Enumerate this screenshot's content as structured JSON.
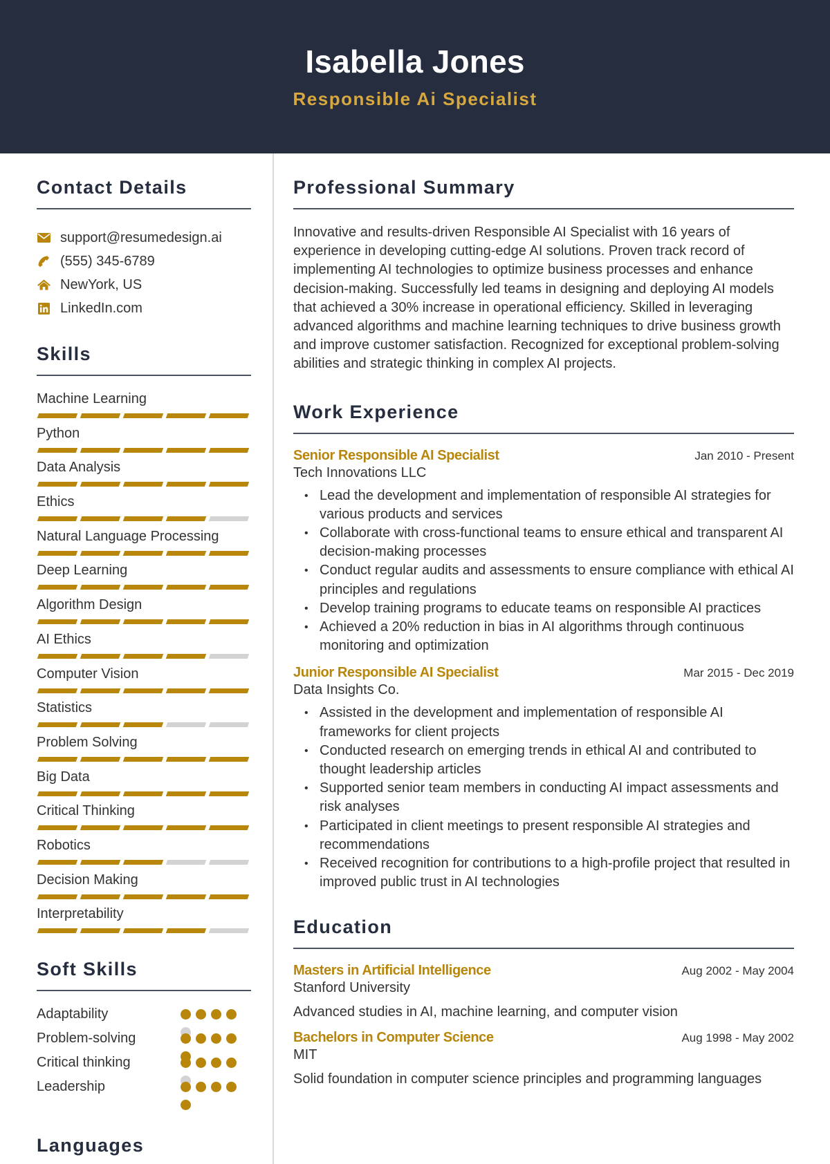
{
  "header": {
    "name": "Isabella Jones",
    "title": "Responsible Ai Specialist"
  },
  "colors": {
    "header_bg": "#252d3e",
    "accent": "#b8860b",
    "title_gold": "#d7a83f",
    "inactive": "#d3d3d3"
  },
  "contact": {
    "heading": "Contact Details",
    "items": [
      {
        "icon": "envelope-icon",
        "text": "support@resumedesign.ai"
      },
      {
        "icon": "phone-icon",
        "text": "(555) 345-6789"
      },
      {
        "icon": "home-icon",
        "text": "NewYork, US"
      },
      {
        "icon": "linkedin-icon",
        "text": "LinkedIn.com"
      }
    ]
  },
  "skills": {
    "heading": "Skills",
    "max": 5,
    "items": [
      {
        "name": "Machine Learning",
        "level": 5
      },
      {
        "name": "Python",
        "level": 5
      },
      {
        "name": "Data Analysis",
        "level": 5
      },
      {
        "name": "Ethics",
        "level": 4
      },
      {
        "name": "Natural Language Processing",
        "level": 5
      },
      {
        "name": "Deep Learning",
        "level": 5
      },
      {
        "name": "Algorithm Design",
        "level": 5
      },
      {
        "name": "AI Ethics",
        "level": 4
      },
      {
        "name": "Computer Vision",
        "level": 5
      },
      {
        "name": "Statistics",
        "level": 3
      },
      {
        "name": "Problem Solving",
        "level": 5
      },
      {
        "name": "Big Data",
        "level": 5
      },
      {
        "name": "Critical Thinking",
        "level": 5
      },
      {
        "name": "Robotics",
        "level": 3
      },
      {
        "name": "Decision Making",
        "level": 5
      },
      {
        "name": "Interpretability",
        "level": 4
      }
    ]
  },
  "soft_skills": {
    "heading": "Soft Skills",
    "max": 5,
    "items": [
      {
        "name": "Adaptability",
        "level": 4
      },
      {
        "name": "Problem-solving",
        "level": 5
      },
      {
        "name": "Critical thinking",
        "level": 4
      },
      {
        "name": "Leadership",
        "level": 5
      }
    ]
  },
  "languages": {
    "heading": "Languages"
  },
  "summary": {
    "heading": "Professional Summary",
    "text": "Innovative and results-driven Responsible AI Specialist with 16 years of experience in developing cutting-edge AI solutions. Proven track record of implementing AI technologies to optimize business processes and enhance decision-making. Successfully led teams in designing and deploying AI models that achieved a 30% increase in operational efficiency. Skilled in leveraging advanced algorithms and machine learning techniques to drive business growth and improve customer satisfaction. Recognized for exceptional problem-solving abilities and strategic thinking in complex AI projects."
  },
  "experience": {
    "heading": "Work Experience",
    "jobs": [
      {
        "title": "Senior Responsible AI Specialist",
        "dates": "Jan 2010 - Present",
        "org": "Tech Innovations LLC",
        "bullets": [
          "Lead the development and implementation of responsible AI strategies for various products and services",
          "Collaborate with cross-functional teams to ensure ethical and transparent AI decision-making processes",
          "Conduct regular audits and assessments to ensure compliance with ethical AI principles and regulations",
          "Develop training programs to educate teams on responsible AI practices",
          "Achieved a 20% reduction in bias in AI algorithms through continuous monitoring and optimization"
        ]
      },
      {
        "title": "Junior Responsible AI Specialist",
        "dates": "Mar 2015 - Dec 2019",
        "org": "Data Insights Co.",
        "bullets": [
          "Assisted in the development and implementation of responsible AI frameworks for client projects",
          "Conducted research on emerging trends in ethical AI and contributed to thought leadership articles",
          "Supported senior team members in conducting AI impact assessments and risk analyses",
          "Participated in client meetings to present responsible AI strategies and recommendations",
          "Received recognition for contributions to a high-profile project that resulted in improved public trust in AI technologies"
        ]
      }
    ]
  },
  "education": {
    "heading": "Education",
    "items": [
      {
        "degree": "Masters in Artificial Intelligence",
        "dates": "Aug 2002 - May 2004",
        "school": "Stanford University",
        "desc": "Advanced studies in AI, machine learning, and computer vision"
      },
      {
        "degree": "Bachelors in Computer Science",
        "dates": "Aug 1998 - May 2002",
        "school": "MIT",
        "desc": "Solid foundation in computer science principles and programming languages"
      }
    ]
  }
}
